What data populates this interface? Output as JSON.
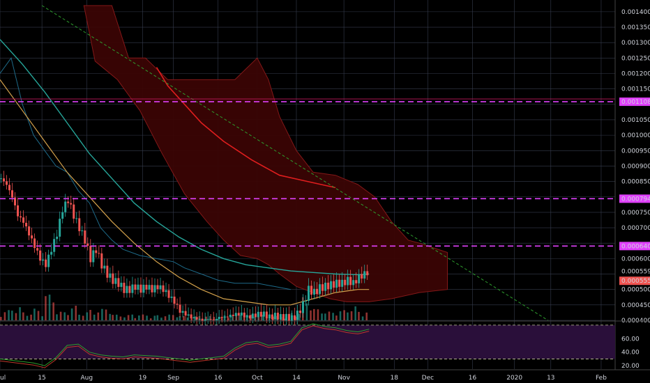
{
  "chart_data": [
    {
      "type": "candlestick",
      "title": "",
      "colors": {
        "up": "#26a69a",
        "down": "#ef5350",
        "background": "#000000",
        "grid": "#363c4e",
        "cloud_fill": "#3a0505",
        "cloud_edge": "#8b1a1a",
        "ma_red": "#e01e1e",
        "ma_teal": "#26a69a",
        "ma_orange": "#d4a24c",
        "donchian": "#1e6b8a",
        "trendline": "#2e9e2e",
        "level_line": "#e040fb",
        "last_price_tag": "#ef5350"
      },
      "y_axis": {
        "range": [
          0.0004,
          0.00142
        ],
        "ticks": [
          "0.0014000",
          "0.0013500",
          "0.0013000",
          "0.0012500",
          "0.0012000",
          "0.0011500",
          "0.0011000",
          "0.0010500",
          "0.0010000",
          "0.0009500",
          "0.0009000",
          "0.0008500",
          "0.0008000",
          "0.0007500",
          "0.0007000",
          "0.0006500",
          "0.0006000",
          "0.0005500",
          "0.0005000",
          "0.0004500",
          "0.0004000"
        ],
        "tick_values": [
          0.0014,
          0.00135,
          0.0013,
          0.00125,
          0.0012,
          0.00115,
          0.0011,
          0.00105,
          0.001,
          0.00095,
          0.0009,
          0.00085,
          0.0008,
          0.00075,
          0.0007,
          0.00065,
          0.0006,
          0.00055,
          0.0005,
          0.00045,
          0.0004
        ]
      },
      "x_axis": {
        "ticks": [
          "ul",
          "15",
          "Aug",
          "19",
          "Sep",
          "16",
          "Oct",
          "14",
          "Nov",
          "18",
          "Dec",
          "16",
          "2020",
          "13",
          "Feb"
        ],
        "tick_days": [
          0,
          15,
          31,
          51,
          62,
          78,
          92,
          106,
          123,
          141,
          153,
          169,
          184,
          197,
          215
        ],
        "range_days": [
          0,
          220
        ]
      },
      "price_levels": [
        {
          "label": "0.0011084",
          "value": 0.0011084
        },
        {
          "label": "0.0007941",
          "value": 0.0007941
        },
        {
          "label": "0.0006407",
          "value": 0.0006407
        }
      ],
      "current_price": {
        "label_current": "0.0005592",
        "value_current": 0.0005592,
        "label_tag": "0.0005552",
        "value_tag": 0.0005552
      },
      "candles_close_path": [
        [
          0,
          0.00086
        ],
        [
          2,
          0.00084
        ],
        [
          4,
          0.0008
        ],
        [
          6,
          0.00074
        ],
        [
          8,
          0.00072
        ],
        [
          10,
          0.00068
        ],
        [
          12,
          0.00064
        ],
        [
          14,
          0.0006
        ],
        [
          16,
          0.00058
        ],
        [
          18,
          0.00063
        ],
        [
          20,
          0.00068
        ],
        [
          22,
          0.00076
        ],
        [
          24,
          0.00079
        ],
        [
          26,
          0.00074
        ],
        [
          28,
          0.0007
        ],
        [
          30,
          0.00066
        ],
        [
          32,
          0.0006
        ],
        [
          34,
          0.00063
        ],
        [
          36,
          0.00058
        ],
        [
          38,
          0.00055
        ],
        [
          40,
          0.00053
        ],
        [
          42,
          0.00052
        ],
        [
          44,
          0.0005
        ],
        [
          46,
          0.0005
        ],
        [
          48,
          0.00051
        ],
        [
          50,
          0.0005
        ],
        [
          52,
          0.00051
        ],
        [
          54,
          0.0005
        ],
        [
          56,
          0.00051
        ],
        [
          58,
          0.0005
        ],
        [
          60,
          0.00048
        ],
        [
          62,
          0.00046
        ],
        [
          64,
          0.00043
        ],
        [
          66,
          0.00042
        ],
        [
          68,
          0.00041
        ],
        [
          70,
          0.000405
        ],
        [
          72,
          0.0004
        ],
        [
          74,
          0.000405
        ],
        [
          76,
          0.0004
        ],
        [
          78,
          0.00041
        ],
        [
          80,
          0.00041
        ],
        [
          82,
          0.000415
        ],
        [
          84,
          0.00042
        ],
        [
          86,
          0.00042
        ],
        [
          88,
          0.00041
        ],
        [
          90,
          0.000415
        ],
        [
          92,
          0.00042
        ],
        [
          94,
          0.00042
        ],
        [
          96,
          0.00041
        ],
        [
          98,
          0.000415
        ],
        [
          100,
          0.00041
        ],
        [
          102,
          0.00041
        ],
        [
          104,
          0.000405
        ],
        [
          106,
          0.00042
        ],
        [
          108,
          0.00045
        ],
        [
          110,
          0.0005
        ],
        [
          112,
          0.00049
        ],
        [
          114,
          0.000505
        ],
        [
          116,
          0.00051
        ],
        [
          118,
          0.000515
        ],
        [
          120,
          0.00052
        ],
        [
          122,
          0.00052
        ],
        [
          124,
          0.00053
        ],
        [
          126,
          0.00052
        ],
        [
          128,
          0.00054
        ],
        [
          130,
          0.00055
        ],
        [
          132,
          0.00056
        ]
      ],
      "volume_path": [
        [
          0,
          0.35
        ],
        [
          4,
          0.5
        ],
        [
          8,
          0.3
        ],
        [
          12,
          0.4
        ],
        [
          16,
          0.9
        ],
        [
          20,
          0.3
        ],
        [
          24,
          0.5
        ],
        [
          28,
          0.3
        ],
        [
          32,
          0.4
        ],
        [
          40,
          0.2
        ],
        [
          48,
          0.2
        ],
        [
          56,
          0.2
        ],
        [
          64,
          0.15
        ],
        [
          72,
          0.15
        ],
        [
          80,
          0.2
        ],
        [
          88,
          0.2
        ],
        [
          96,
          0.15
        ],
        [
          104,
          0.3
        ],
        [
          108,
          0.8
        ],
        [
          112,
          0.4
        ],
        [
          116,
          0.3
        ],
        [
          120,
          0.35
        ],
        [
          124,
          0.5
        ],
        [
          128,
          0.35
        ],
        [
          132,
          0.4
        ]
      ],
      "oscillator": {
        "ticks": [
          "60.00",
          "40.00",
          "20.00"
        ],
        "tick_values": [
          60,
          40,
          20
        ],
        "range": [
          15,
          85
        ],
        "overbought": 80,
        "oversold": 30,
        "values": [
          [
            0,
            30
          ],
          [
            4,
            28
          ],
          [
            8,
            26
          ],
          [
            12,
            24
          ],
          [
            16,
            20
          ],
          [
            20,
            32
          ],
          [
            24,
            50
          ],
          [
            28,
            52
          ],
          [
            32,
            40
          ],
          [
            36,
            36
          ],
          [
            40,
            34
          ],
          [
            44,
            33
          ],
          [
            48,
            36
          ],
          [
            52,
            35
          ],
          [
            56,
            34
          ],
          [
            60,
            32
          ],
          [
            64,
            30
          ],
          [
            68,
            28
          ],
          [
            72,
            30
          ],
          [
            76,
            32
          ],
          [
            80,
            34
          ],
          [
            84,
            46
          ],
          [
            88,
            54
          ],
          [
            92,
            56
          ],
          [
            96,
            50
          ],
          [
            100,
            52
          ],
          [
            104,
            56
          ],
          [
            108,
            76
          ],
          [
            112,
            82
          ],
          [
            116,
            78
          ],
          [
            120,
            76
          ],
          [
            124,
            72
          ],
          [
            128,
            70
          ],
          [
            132,
            74
          ]
        ]
      }
    }
  ]
}
